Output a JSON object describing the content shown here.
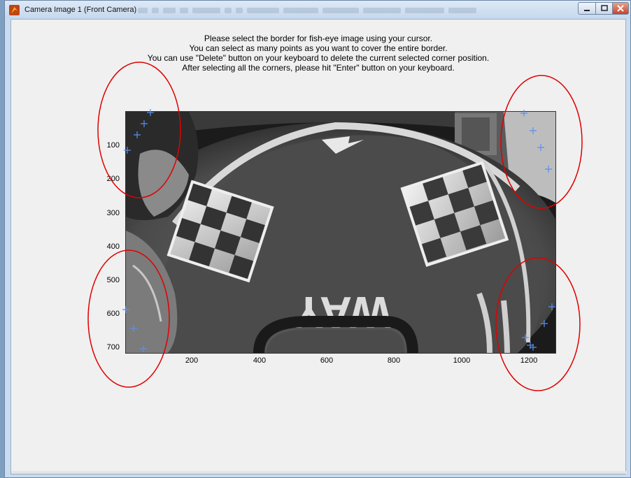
{
  "window": {
    "title": "Camera Image 1 (Front Camera)",
    "controls": {
      "minimize_icon": "minimize-icon",
      "maximize_icon": "maximize-icon",
      "close_icon": "close-icon"
    }
  },
  "instructions": [
    "Please select the border for fish-eye image using your cursor.",
    "You can select as many points as you want to cover the entire border.",
    "You can use \"Delete\" button on your keyboard to delete the current selected corner position.",
    "After selecting all the corners, please hit \"Enter\" button on your keyboard."
  ],
  "axes": {
    "x_ticks": [
      "200",
      "400",
      "600",
      "800",
      "1000",
      "1200"
    ],
    "y_ticks": [
      "100",
      "200",
      "300",
      "400",
      "500",
      "600",
      "700"
    ]
  },
  "image_labels": [
    "WAY"
  ],
  "colors": {
    "marker": "#5a8ff0",
    "highlight_ellipse": "#e00000"
  },
  "selected_points_count": 16
}
